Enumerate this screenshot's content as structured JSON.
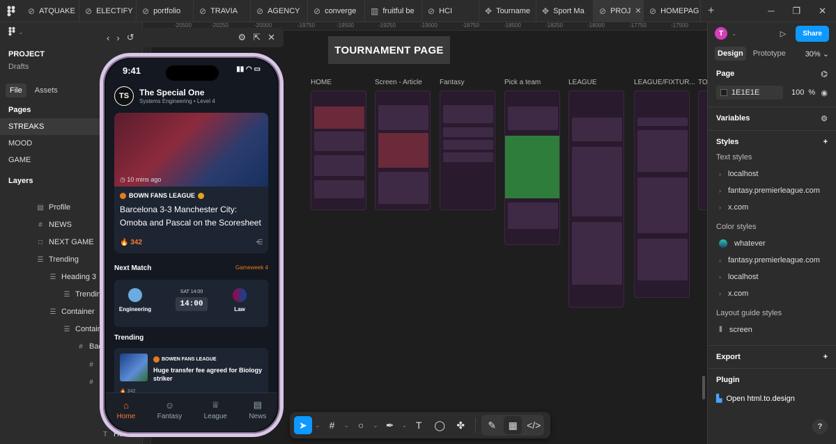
{
  "tabs": [
    "ATQUAKE",
    "ELECTIFY",
    "portfolio",
    "TRAVIA",
    "AGENCY",
    "converge",
    "fruitful be",
    "HCI",
    "Tourname",
    "Sport Ma",
    "PROJ",
    "HOMEPAG"
  ],
  "left": {
    "project_name": "PROJECT",
    "project_sub": "Drafts",
    "file_tab": "File",
    "assets_tab": "Assets",
    "pages_title": "Pages",
    "pages": [
      "STREAKS",
      "MOOD",
      "GAME"
    ],
    "layers_title": "Layers",
    "layers": [
      "Profile",
      "NEWS",
      "NEXT GAME",
      "Trending",
      "Heading 3",
      "Trending",
      "Container",
      "Containe",
      "Back",
      "He"
    ]
  },
  "canvas": {
    "ruler": [
      "-20500",
      "-20250",
      "-20000",
      "-19750",
      "-19500",
      "-19250",
      "-19000",
      "-18750",
      "-18500",
      "-18250",
      "-18000",
      "-17750",
      "-17500"
    ],
    "section_title": "TOURNAMENT PAGE",
    "frame_labels": [
      "HOME",
      "Screen - Article",
      "Fantasy",
      "Pick a team",
      "LEAGUE",
      "LEAGUE/FIXTUR...",
      "TO"
    ]
  },
  "phone": {
    "time": "9:41",
    "initials": "TS",
    "user_name": "The Special One",
    "user_sub": "Systems Engineering • Level 4",
    "card": {
      "time_ago": "10 mins ago",
      "league": "BOWN FANS LEAGUE",
      "headline": "Barcelona 3-3 Manchester City: Omoba and Pascal on the Scoresheet",
      "fire_count": "342"
    },
    "next_match": {
      "title": "Next Match",
      "gameweek": "Gameweek 4",
      "home": "Engineering",
      "away": "Law",
      "day": "SAT 14:00",
      "kickoff": "14:00"
    },
    "trending": {
      "title": "Trending",
      "league": "BOWEN FANS LEAGUE",
      "headline": "Huge transfer fee agreed for Biology striker",
      "count": "342"
    },
    "nav": [
      "Home",
      "Fantasy",
      "League",
      "News"
    ]
  },
  "right": {
    "avatar": "T",
    "share": "Share",
    "design_tab": "Design",
    "prototype_tab": "Prototype",
    "zoom": "30%",
    "page_title": "Page",
    "page_color": "1E1E1E",
    "page_opacity": "100",
    "percent": "%",
    "variables": "Variables",
    "styles": "Styles",
    "text_styles_title": "Text styles",
    "text_styles": [
      "localhost",
      "fantasy.premierleague.com",
      "x.com"
    ],
    "color_styles_title": "Color styles",
    "color_styles": [
      "whatever",
      "fantasy.premierleague.com",
      "localhost",
      "x.com"
    ],
    "layout_title": "Layout guide styles",
    "layout_item": "screen",
    "export": "Export",
    "plugin": "Plugin",
    "plugin_item": "Open html.to.design",
    "help": "?"
  },
  "colors": {
    "accent": "#0d99ff",
    "orange": "#ff7a2e",
    "canvas": "#1e1e1e",
    "panel": "#2c2c2c"
  }
}
